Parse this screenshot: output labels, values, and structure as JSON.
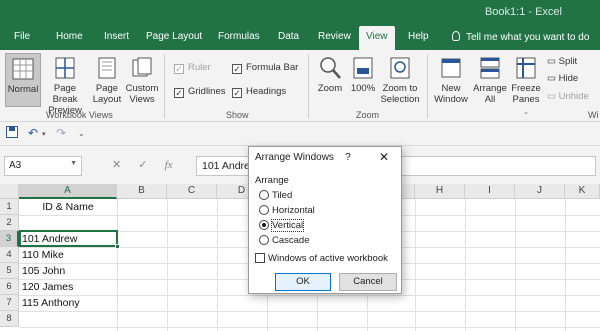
{
  "window": {
    "title": "Book1:1  -  Excel"
  },
  "menu": {
    "tabs": [
      "File",
      "Home",
      "Insert",
      "Page Layout",
      "Formulas",
      "Data",
      "Review",
      "View",
      "Help"
    ],
    "active": "View",
    "tell_me": "Tell me what you want to do"
  },
  "ribbon": {
    "workbook_views": {
      "label": "Workbook Views",
      "normal": "Normal",
      "page_break_1": "Page Break",
      "page_break_2": "Preview",
      "page_layout_1": "Page",
      "page_layout_2": "Layout",
      "custom_1": "Custom",
      "custom_2": "Views"
    },
    "show": {
      "label": "Show",
      "ruler": "Ruler",
      "formula_bar": "Formula Bar",
      "gridlines": "Gridlines",
      "headings": "Headings"
    },
    "zoom": {
      "label": "Zoom",
      "zoom": "Zoom",
      "hundred": "100%",
      "zoom_sel_1": "Zoom to",
      "zoom_sel_2": "Selection"
    },
    "window": {
      "new_1": "New",
      "new_2": "Window",
      "arrange_1": "Arrange",
      "arrange_2": "All",
      "freeze_1": "Freeze",
      "freeze_2": "Panes",
      "split": "Split",
      "hide": "Hide",
      "unhide": "Unhide",
      "label_partial": "Wi"
    }
  },
  "namebox": {
    "value": "A3"
  },
  "formula": {
    "fx": "fx",
    "value": "101 Andrew"
  },
  "grid": {
    "columns": [
      "A",
      "B",
      "C",
      "D",
      "E",
      "F",
      "G",
      "H",
      "I",
      "J",
      "K"
    ],
    "rows": [
      "1",
      "2",
      "3",
      "4",
      "5",
      "6",
      "7",
      "8"
    ],
    "cells": {
      "a1": "ID & Name",
      "a3": "101 Andrew",
      "a4": "110 Mike",
      "a5": "105 John",
      "a6": "120 James",
      "a7": "115 Anthony"
    }
  },
  "dialog": {
    "title": "Arrange Windows",
    "help": "?",
    "close": "✕",
    "section": "Arrange",
    "options": [
      "Tiled",
      "Horizontal",
      "Vertical",
      "Cascade"
    ],
    "selected": "Vertical",
    "checkbox": "Windows of active workbook",
    "ok": "OK",
    "cancel": "Cancel"
  },
  "colors": {
    "accent": "#217346",
    "focus_blue": "#0078d7"
  },
  "icons": [
    "lightbulb-icon",
    "save-icon",
    "undo-icon",
    "redo-icon",
    "customize-qat-icon",
    "cancel-x-icon",
    "enter-check-icon"
  ]
}
